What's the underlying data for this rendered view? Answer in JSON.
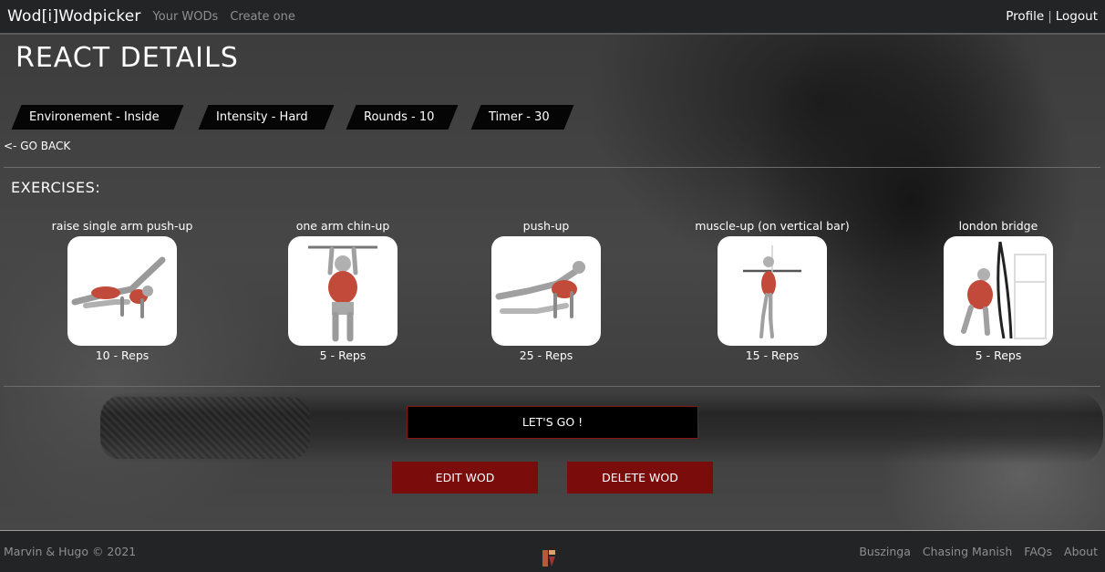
{
  "navbar": {
    "brand": "Wod[i]Wodpicker",
    "links": [
      "Your WODs",
      "Create one"
    ],
    "profile": "Profile",
    "separator": "|",
    "logout": "Logout"
  },
  "page": {
    "title": "REACT DETAILS",
    "tags": [
      "Environement - Inside",
      "Intensity - Hard",
      "Rounds - 10",
      "Timer - 30"
    ],
    "go_back": "<- GO BACK",
    "exercises_heading": "EXERCISES:"
  },
  "exercises": [
    {
      "name": "raise single arm push-up",
      "reps": "10 - Reps",
      "icon": "push-up-figure-icon"
    },
    {
      "name": "one arm chin-up",
      "reps": "5 - Reps",
      "icon": "chin-up-figure-icon"
    },
    {
      "name": "push-up",
      "reps": "25 - Reps",
      "icon": "push-up-figure-icon"
    },
    {
      "name": "muscle-up (on vertical bar)",
      "reps": "15 - Reps",
      "icon": "muscle-up-figure-icon"
    },
    {
      "name": "london bridge",
      "reps": "5 - Reps",
      "icon": "rope-figure-icon"
    }
  ],
  "actions": {
    "lets_go": "LET'S GO !",
    "edit": "EDIT WOD",
    "delete": "DELETE WOD"
  },
  "footer": {
    "copyright": "Marvin & Hugo © 2021",
    "links": [
      "Buszinga",
      "Chasing Manish",
      "FAQs",
      "About"
    ]
  },
  "colors": {
    "navbar_bg": "#222426",
    "accent_red": "#7b0c0c",
    "tag_bg": "#050505"
  }
}
